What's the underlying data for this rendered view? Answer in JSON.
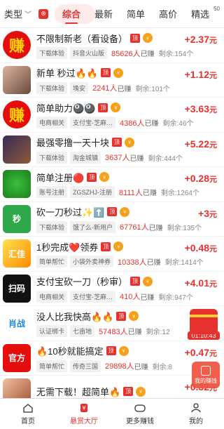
{
  "header": {
    "type_label": "类型",
    "tabs": [
      "综合",
      "最新",
      "简单",
      "高价",
      "精选"
    ],
    "active_tab": 0,
    "badge": "50"
  },
  "tasks": [
    {
      "title": "不限制新老（看设备）",
      "tags": [
        "下载体验",
        "抖音火山版"
      ],
      "earned": "85626人",
      "suffix": "已赚",
      "remaining": "剩余:154个",
      "reward": "+2.37",
      "unit": "元",
      "pill": "顶",
      "thumb": "zhuan"
    },
    {
      "title": "新单 秒过🔥🔥",
      "tags": [
        "下载体验",
        "堍安"
      ],
      "earned": "2241人",
      "suffix": "已赚",
      "remaining": "剩余:101个",
      "reward": "+1.12",
      "unit": "元",
      "pill": "顶",
      "thumb": "face"
    },
    {
      "title": "简单助力🎱🎱",
      "tags": [
        "电商相关",
        "支付宝-芝麻…"
      ],
      "earned": "4386人",
      "suffix": "已赚",
      "remaining": "剩余:46个",
      "reward": "+3.63",
      "unit": "元",
      "pill": "顶",
      "thumb": "zhuan"
    },
    {
      "title": "最强零撸一天十块",
      "tags": [
        "下载体验",
        "淘金城镇"
      ],
      "earned": "3637人",
      "suffix": "已赚",
      "remaining": "剩余:444个",
      "reward": "+5.22",
      "unit": "元",
      "pill": "顶",
      "thumb": "dark"
    },
    {
      "title": "简单注册🔴",
      "tags": [
        "账号注册",
        "ZGSZHJ-注册"
      ],
      "earned": "8111人",
      "suffix": "已赚",
      "remaining": "剩余:1264个",
      "reward": "+0.28",
      "unit": "元",
      "pill": "顶",
      "thumb": "green"
    },
    {
      "title": "砍一刀秒过✨⬆️",
      "tags": [
        "下载体验",
        "饿了么-新用户"
      ],
      "earned": "67761人",
      "suffix": "已赚",
      "remaining": "剩余:135个",
      "reward": "+3",
      "unit": "元",
      "pill": "顶",
      "thumb": "miao"
    },
    {
      "title": "1秒完成❤️领券",
      "tags": [
        "简单帮忙",
        "小袋外卖神券"
      ],
      "earned": "10338人",
      "suffix": "已赚",
      "remaining": "剩余:1414个",
      "reward": "+0.48",
      "unit": "元",
      "pill": "顶",
      "thumb": "huijia"
    },
    {
      "title": "支付宝砍一刀（秒审）",
      "tags": [
        "电商相关",
        "支付宝-芝麻…"
      ],
      "earned": "410人",
      "suffix": "已赚",
      "remaining": "剩余:947个",
      "reward": "+4.01",
      "unit": "元",
      "pill": "顶",
      "thumb": "qr"
    },
    {
      "title": "没人比我快高🔥🔥",
      "tags": [
        "认证绑卡",
        "七亩地"
      ],
      "earned": "57483人",
      "suffix": "已赚",
      "remaining": "剩余:12",
      "reward": "+",
      "unit": "",
      "pill": "顶",
      "thumb": "xiaozhan"
    },
    {
      "title": "🔥10秒就能搞定",
      "tags": [
        "简单帮忙",
        "传奇三国"
      ],
      "earned": "29898人",
      "suffix": "已赚",
      "remaining": "剩余:8",
      "reward": "+0.47",
      "unit": "元",
      "pill": "顶",
      "thumb": "guanfang"
    },
    {
      "title": "无需下载！超简单🔥",
      "tags": [],
      "earned": "",
      "suffix": "",
      "remaining": "",
      "reward": "+0.32",
      "unit": "元",
      "pill": "顶",
      "thumb": "face2"
    }
  ],
  "float": {
    "timer": "01:10:43",
    "earn_label": "我的赚钱"
  },
  "bottom_nav": [
    "首页",
    "悬赏大厅",
    "更多赚钱",
    "我的"
  ],
  "colors": {
    "accent": "#e6322e",
    "coin": "#f7a11b"
  }
}
